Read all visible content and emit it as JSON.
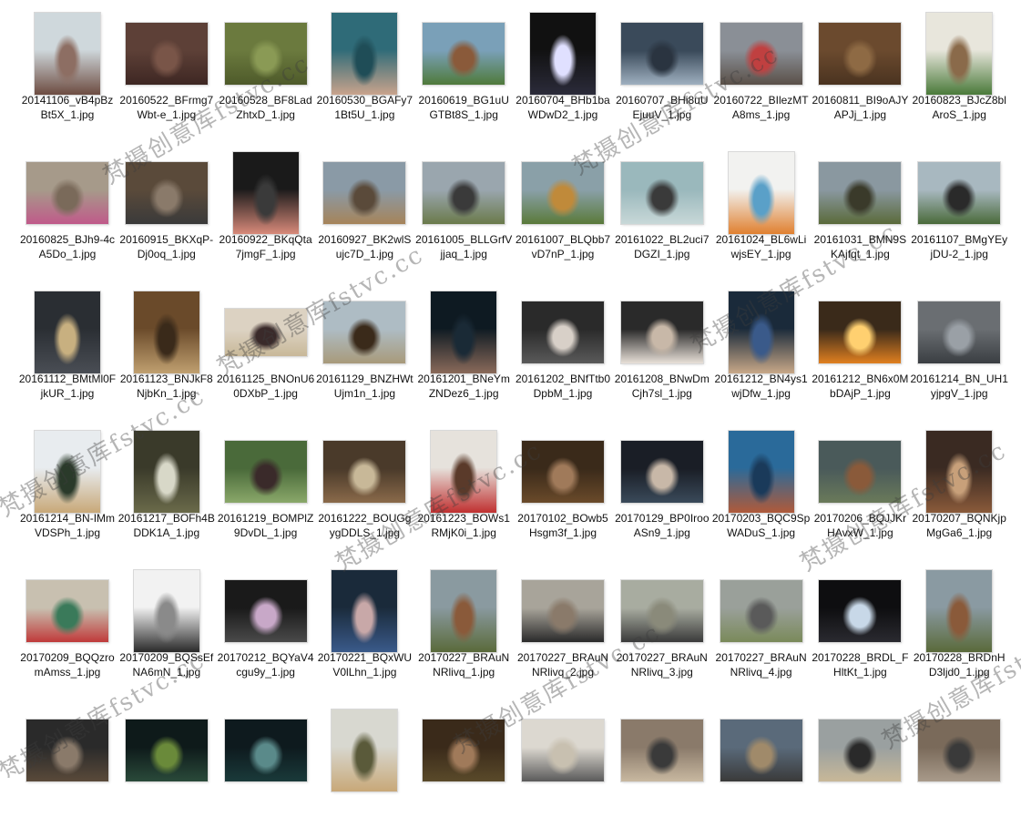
{
  "window": {
    "title": ""
  },
  "watermark_text": "梵摄创意库fstvc.cc",
  "files": [
    {
      "name": "20141106_vB4pBzBt5X_1.jpg",
      "thumb": "portrait",
      "colors": [
        "#cfd8dc",
        "#6d4c41",
        "#8d6e63"
      ]
    },
    {
      "name": "20160522_BFrmg7Wbt-e_1.jpg",
      "thumb": "landscape",
      "colors": [
        "#5d4037",
        "#3e2723",
        "#795548"
      ]
    },
    {
      "name": "20160528_BF8LadZhtxD_1.jpg",
      "thumb": "landscape",
      "colors": [
        "#6b7a3e",
        "#4e5a2a",
        "#8a9a55"
      ]
    },
    {
      "name": "20160530_BGAFy71Bt5U_1.jpg",
      "thumb": "square",
      "colors": [
        "#2f6b78",
        "#c9a38c",
        "#1f4d57"
      ]
    },
    {
      "name": "20160619_BG1uUGTBt8S_1.jpg",
      "thumb": "landscape",
      "colors": [
        "#7aa0b8",
        "#4f7a3a",
        "#8a5a3a"
      ]
    },
    {
      "name": "20160704_BHb1baWDwD2_1.jpg",
      "thumb": "portrait",
      "colors": [
        "#111111",
        "#2b2b3a",
        "#e0e0ff"
      ]
    },
    {
      "name": "20160707_BHi8uUEjuuV_1.jpg",
      "thumb": "landscape",
      "colors": [
        "#3a4a5a",
        "#9fb0c0",
        "#2a3440"
      ]
    },
    {
      "name": "20160722_BIlezMTA8ms_1.jpg",
      "thumb": "landscape",
      "colors": [
        "#8a8f96",
        "#5a5048",
        "#c04040"
      ]
    },
    {
      "name": "20160811_BI9oAJYAPJj_1.jpg",
      "thumb": "landscape",
      "colors": [
        "#6b4a2e",
        "#4a3320",
        "#8e6a44"
      ]
    },
    {
      "name": "20160823_BJcZ8blAroS_1.jpg",
      "thumb": "portrait",
      "colors": [
        "#e8e6dc",
        "#4a7a3a",
        "#8a6a4a"
      ]
    },
    {
      "name": "20160825_BJh9-4cA5Do_1.jpg",
      "thumb": "landscape",
      "colors": [
        "#a69a8a",
        "#c05a8a",
        "#7a6a5a"
      ]
    },
    {
      "name": "20160915_BKXqP-Dj0oq_1.jpg",
      "thumb": "landscape",
      "colors": [
        "#5a4a3a",
        "#3a3a3a",
        "#8a7a6a"
      ]
    },
    {
      "name": "20160922_BKqQta7jmgF_1.jpg",
      "thumb": "portrait",
      "colors": [
        "#1a1a1a",
        "#d88a7a",
        "#3a3a3a"
      ]
    },
    {
      "name": "20160927_BK2wlSujc7D_1.jpg",
      "thumb": "landscape",
      "colors": [
        "#8a9aa6",
        "#a6845a",
        "#5a4a3a"
      ]
    },
    {
      "name": "20161005_BLLGrfVjjaq_1.jpg",
      "thumb": "landscape",
      "colors": [
        "#9aa6ae",
        "#6a7a4a",
        "#3a3a3a"
      ]
    },
    {
      "name": "20161007_BLQbb7vD7nP_1.jpg",
      "thumb": "landscape",
      "colors": [
        "#8aa0a8",
        "#5a7a3a",
        "#c08a3a"
      ]
    },
    {
      "name": "20161022_BL2uci7DGZI_1.jpg",
      "thumb": "landscape",
      "colors": [
        "#9ab8bc",
        "#c8d8d8",
        "#3a3a3a"
      ]
    },
    {
      "name": "20161024_BL6wLiwjsEY_1.jpg",
      "thumb": "portrait",
      "colors": [
        "#f2f2f0",
        "#e08030",
        "#5aa0c8"
      ]
    },
    {
      "name": "20161031_BMN9SKAjfqt_1.jpg",
      "thumb": "landscape",
      "colors": [
        "#8a98a0",
        "#5a6a3a",
        "#3a3a2a"
      ]
    },
    {
      "name": "20161107_BMgYEyjDU-2_1.jpg",
      "thumb": "landscape",
      "colors": [
        "#a8b8c0",
        "#4a6a3a",
        "#2a2a2a"
      ]
    },
    {
      "name": "20161112_BMtMl0FjkUR_1.jpg",
      "thumb": "portrait",
      "colors": [
        "#2a2e33",
        "#4a4e55",
        "#c8b080"
      ]
    },
    {
      "name": "20161123_BNJkF8NjbKn_1.jpg",
      "thumb": "portrait",
      "colors": [
        "#6a4a2a",
        "#c0a070",
        "#3a2a1a"
      ]
    },
    {
      "name": "20161125_BNOnU60DXbP_1.jpg",
      "thumb": "wide",
      "colors": [
        "#dcd2c2",
        "#c8b898",
        "#3a2a2a"
      ]
    },
    {
      "name": "20161129_BNZHWtUjm1n_1.jpg",
      "thumb": "landscape",
      "colors": [
        "#aebcc4",
        "#a89a7a",
        "#3a2a1a"
      ]
    },
    {
      "name": "20161201_BNeYmZNDez6_1.jpg",
      "thumb": "portrait",
      "colors": [
        "#0e1a22",
        "#8a6a5a",
        "#1a2a36"
      ]
    },
    {
      "name": "20161202_BNfTtb0DpbM_1.jpg",
      "thumb": "landscape",
      "colors": [
        "#2a2a2a",
        "#5a5a5a",
        "#d8d0c8"
      ]
    },
    {
      "name": "20161208_BNwDmCjh7sl_1.jpg",
      "thumb": "landscape",
      "colors": [
        "#2a2a2a",
        "#e8e0d8",
        "#c8b8a8"
      ]
    },
    {
      "name": "20161212_BN4ys1wjDfw_1.jpg",
      "thumb": "portrait",
      "colors": [
        "#1a2a3a",
        "#c8a888",
        "#3a5a8a"
      ]
    },
    {
      "name": "20161212_BN6x0MbDAjP_1.jpg",
      "thumb": "landscape",
      "colors": [
        "#3a2a1a",
        "#e08020",
        "#ffd070"
      ]
    },
    {
      "name": "20161214_BN_UH1yjpgV_1.jpg",
      "thumb": "landscape",
      "colors": [
        "#6a6e72",
        "#3a3e42",
        "#9aa0a6"
      ]
    },
    {
      "name": "20161214_BN-IMmVDSPh_1.jpg",
      "thumb": "portrait",
      "colors": [
        "#e8ecef",
        "#c8a878",
        "#2a3a2a"
      ]
    },
    {
      "name": "20161217_BOFh4BDDK1A_1.jpg",
      "thumb": "portrait",
      "colors": [
        "#3a3a2a",
        "#6a6a4a",
        "#d8d8c8"
      ]
    },
    {
      "name": "20161219_BOMPlZ9DvDL_1.jpg",
      "thumb": "landscape",
      "colors": [
        "#4a6a3a",
        "#8aa86a",
        "#3a2a2a"
      ]
    },
    {
      "name": "20161222_BOUGgygDDLS_1.jpg",
      "thumb": "landscape",
      "colors": [
        "#4a3a2a",
        "#8a6a4a",
        "#c8b898"
      ]
    },
    {
      "name": "20161223_BOWs1RMjK0i_1.jpg",
      "thumb": "portrait",
      "colors": [
        "#e6e2dc",
        "#c03030",
        "#5a3a2a"
      ]
    },
    {
      "name": "20170102_BOwb5Hsgm3f_1.jpg",
      "thumb": "landscape",
      "colors": [
        "#3a2a1a",
        "#6a4a2a",
        "#a07a5a"
      ]
    },
    {
      "name": "20170129_BP0IrooASn9_1.jpg",
      "thumb": "landscape",
      "colors": [
        "#1a1e26",
        "#3a4a5a",
        "#c8b8a8"
      ]
    },
    {
      "name": "20170203_BQC9SpWADuS_1.jpg",
      "thumb": "portrait",
      "colors": [
        "#2a6a9a",
        "#b05a3a",
        "#1a3a5a"
      ]
    },
    {
      "name": "20170206_BQJJKrHAvxW_1.jpg",
      "thumb": "landscape",
      "colors": [
        "#4a5a5a",
        "#6a7a5a",
        "#8a5a3a"
      ]
    },
    {
      "name": "20170207_BQNKjpMgGa6_1.jpg",
      "thumb": "portrait",
      "colors": [
        "#3a2a22",
        "#8a5a3a",
        "#c8a07a"
      ]
    },
    {
      "name": "20170209_BQQzromAmss_1.jpg",
      "thumb": "landscape",
      "colors": [
        "#c8c0b0",
        "#c03a3a",
        "#3a7a5a"
      ]
    },
    {
      "name": "20170209_BQSsEfNA6mN_1.jpg",
      "thumb": "portrait",
      "colors": [
        "#f2f2f2",
        "#2a2a2a",
        "#8a8a8a"
      ]
    },
    {
      "name": "20170212_BQYaV4cgu9y_1.jpg",
      "thumb": "landscape",
      "colors": [
        "#1a1a1a",
        "#4a4a4a",
        "#c8a8c8"
      ]
    },
    {
      "name": "20170221_BQxWUV0lLhn_1.jpg",
      "thumb": "portrait",
      "colors": [
        "#1a2a3a",
        "#3a5a8a",
        "#c8a8a8"
      ]
    },
    {
      "name": "20170227_BRAuNNRlivq_1.jpg",
      "thumb": "portrait",
      "colors": [
        "#8a9aa0",
        "#5a6a3a",
        "#8a5a3a"
      ]
    },
    {
      "name": "20170227_BRAuNNRlivq_2.jpg",
      "thumb": "landscape",
      "colors": [
        "#a8a49a",
        "#2a2a2a",
        "#8a7a6a"
      ]
    },
    {
      "name": "20170227_BRAuNNRlivq_3.jpg",
      "thumb": "landscape",
      "colors": [
        "#a8aca0",
        "#3a3a3a",
        "#8a8a7a"
      ]
    },
    {
      "name": "20170227_BRAuNNRlivq_4.jpg",
      "thumb": "landscape",
      "colors": [
        "#9aa09a",
        "#7a8a5a",
        "#5a5a5a"
      ]
    },
    {
      "name": "20170228_BRDL_FHltKt_1.jpg",
      "thumb": "landscape",
      "colors": [
        "#0e0e10",
        "#2a2a30",
        "#c8d8e8"
      ]
    },
    {
      "name": "20170228_BRDnHD3ljd0_1.jpg",
      "thumb": "portrait",
      "colors": [
        "#8a9aa2",
        "#5a6a3a",
        "#8a5a3a"
      ]
    },
    {
      "name": "",
      "thumb": "landscape",
      "colors": [
        "#2a2a2a",
        "#5a4a3a",
        "#8a7a6a"
      ]
    },
    {
      "name": "",
      "thumb": "landscape",
      "colors": [
        "#0e1a1a",
        "#2a4a3a",
        "#6a8a3a"
      ]
    },
    {
      "name": "",
      "thumb": "landscape",
      "colors": [
        "#0e1a1e",
        "#1a3a3a",
        "#5a8a8a"
      ]
    },
    {
      "name": "",
      "thumb": "portrait",
      "colors": [
        "#d8d8d0",
        "#c8a878",
        "#5a5a3a"
      ]
    },
    {
      "name": "",
      "thumb": "landscape",
      "colors": [
        "#3a2a1a",
        "#5a4a2a",
        "#a07a5a"
      ]
    },
    {
      "name": "",
      "thumb": "landscape",
      "colors": [
        "#dcd8d0",
        "#5a5a5a",
        "#c8c0b0"
      ]
    },
    {
      "name": "",
      "thumb": "landscape",
      "colors": [
        "#8a7a6a",
        "#c8b8a0",
        "#3a3a3a"
      ]
    },
    {
      "name": "",
      "thumb": "landscape",
      "colors": [
        "#5a6a7a",
        "#3a3a3a",
        "#a08a6a"
      ]
    },
    {
      "name": "",
      "thumb": "landscape",
      "colors": [
        "#9aa0a0",
        "#c8b898",
        "#2a2a2a"
      ]
    },
    {
      "name": "",
      "thumb": "landscape",
      "colors": [
        "#7a6a5a",
        "#a89a8a",
        "#3a3a3a"
      ]
    }
  ]
}
